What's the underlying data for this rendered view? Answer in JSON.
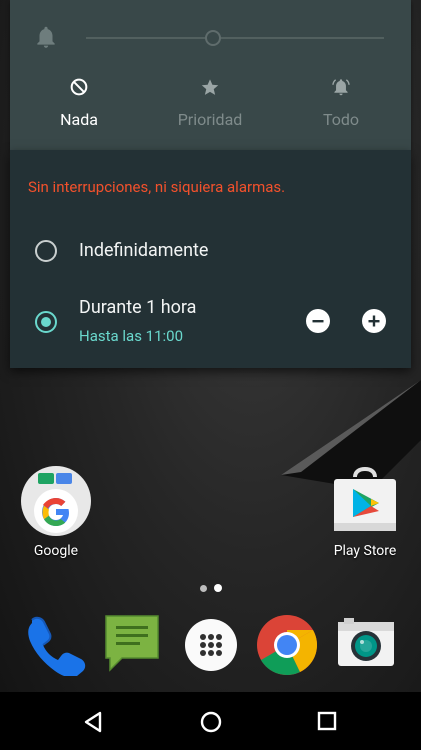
{
  "quick_settings": {
    "modes": [
      {
        "label": "Nada",
        "icon": "block-icon",
        "state": "active"
      },
      {
        "label": "Prioridad",
        "icon": "star-icon",
        "state": "inactive"
      },
      {
        "label": "Todo",
        "icon": "alarm-bell-icon",
        "state": "inactive"
      }
    ],
    "warning_text": "Sin interrupciones, ni siquiera alarmas.",
    "duration_options": [
      {
        "label": "Indefinidamente",
        "selected": false
      },
      {
        "label": "Durante 1 hora",
        "sublabel": "Hasta las 11:00",
        "selected": true
      }
    ]
  },
  "home": {
    "apps": [
      {
        "label": "Google"
      },
      {
        "label": "Play Store"
      }
    ],
    "dock": [
      {
        "icon": "phone-icon"
      },
      {
        "icon": "messaging-icon"
      },
      {
        "icon": "app-drawer-icon"
      },
      {
        "icon": "chrome-icon"
      },
      {
        "icon": "camera-icon"
      }
    ]
  },
  "colors": {
    "accent": "#6ad8cd",
    "warning": "#f2512c",
    "panel_top": "#394849",
    "panel_bottom": "#233135"
  }
}
